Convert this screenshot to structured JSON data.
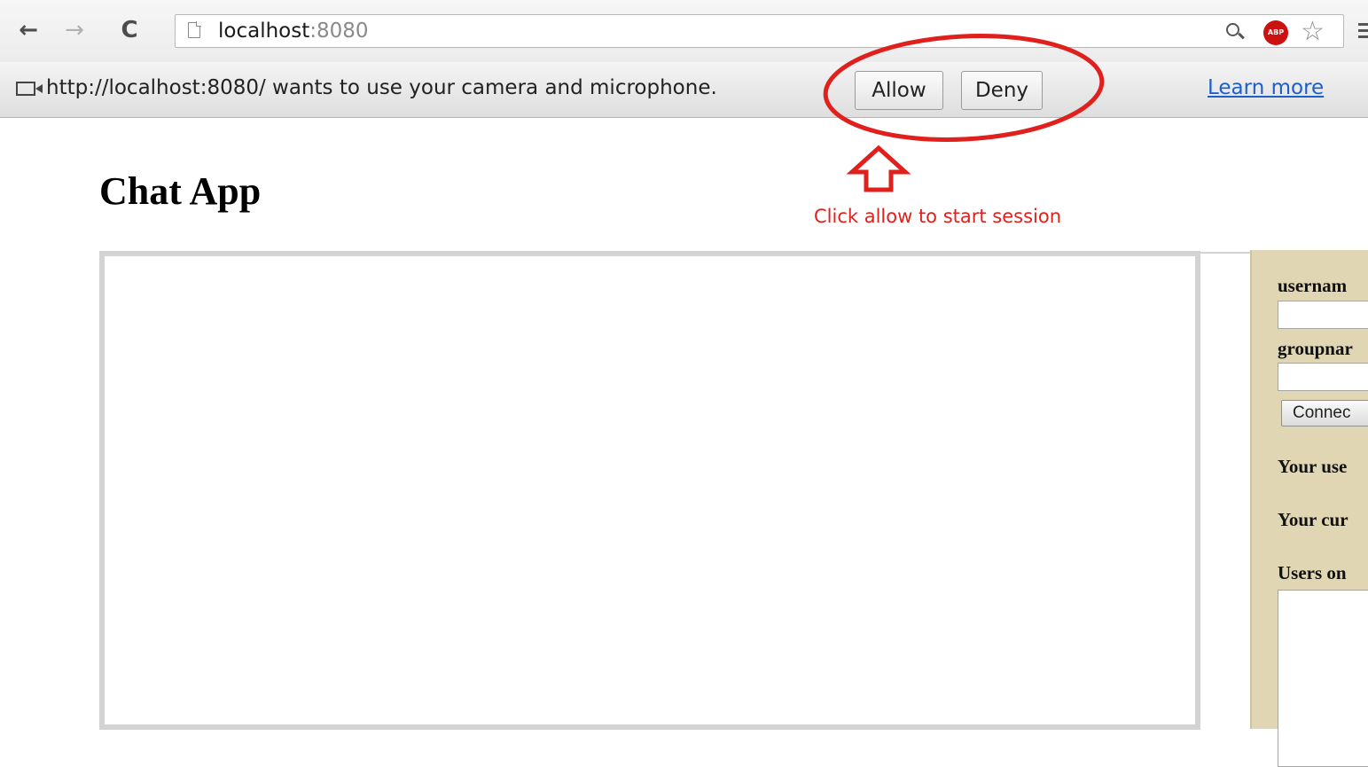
{
  "browser": {
    "url_host": "localhost",
    "url_port": ":8080",
    "abp_label": "ABP"
  },
  "infobar": {
    "message": "http://localhost:8080/ wants to use your camera and microphone.",
    "allow_label": "Allow",
    "deny_label": "Deny",
    "learn_more_label": "Learn more"
  },
  "annotation": {
    "text": "Click allow to start session",
    "color": "#e0201c"
  },
  "page": {
    "title": "Chat App"
  },
  "side_panel": {
    "username_label": "usernam",
    "groupname_label": "groupnar",
    "connect_label": "Connec",
    "your_user_label": "Your use",
    "your_current_label": "Your cur",
    "users_online_label": "Users on",
    "background_color": "#e0d6b4"
  }
}
